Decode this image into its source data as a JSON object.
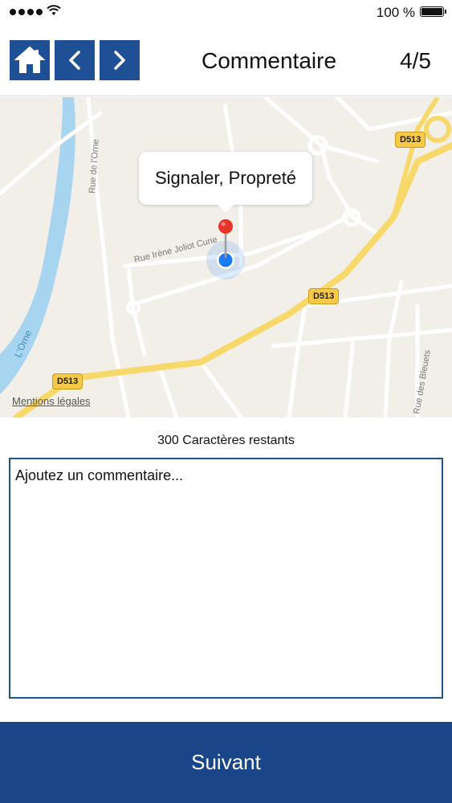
{
  "status_bar": {
    "battery_text": "100 %"
  },
  "header": {
    "title": "Commentaire",
    "page_counter": "4/5",
    "icons": {
      "home": "home-icon",
      "prev": "chevron-left-icon",
      "next": "chevron-right-icon"
    }
  },
  "map": {
    "callout_text": "Signaler, Propreté",
    "legal_link": "Mentions légales",
    "street_labels": [
      "Rue Irène Joliot Curie",
      "Rue de l'Orne",
      "L'Orne",
      "Rue des Bleuets"
    ],
    "road_shields": [
      "D513",
      "D513",
      "D513"
    ]
  },
  "comment": {
    "chars_remaining": "300 Caractères restants",
    "placeholder": "Ajoutez un commentaire...",
    "value": ""
  },
  "footer": {
    "next_label": "Suivant"
  },
  "colors": {
    "primary": "#1f4f95",
    "footer": "#1a4588",
    "road_major": "#f7d96b",
    "river": "#a7d4ef",
    "pin_red": "#e8332a",
    "location_blue": "#1a7cf5"
  }
}
